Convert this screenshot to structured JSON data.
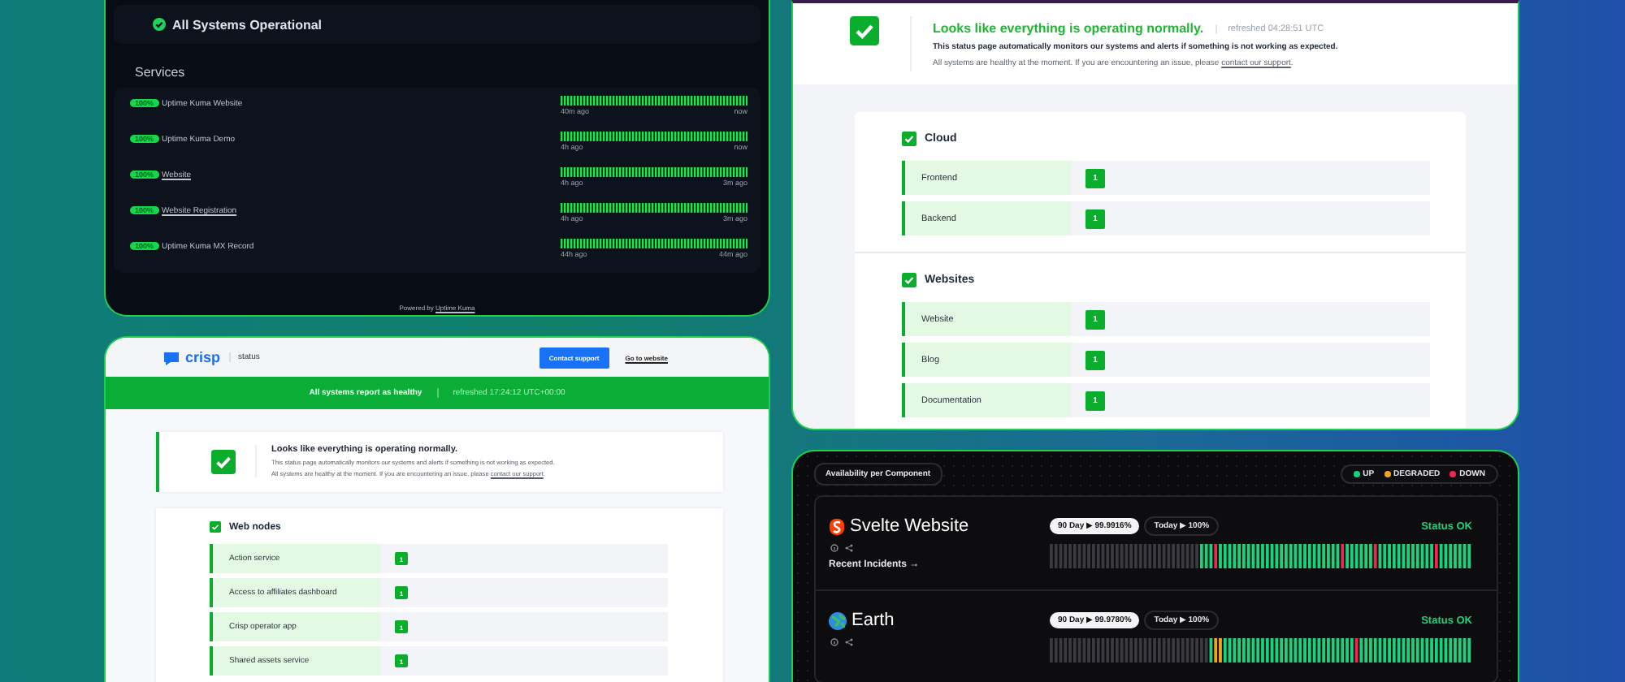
{
  "uptime_page": {
    "banner": "All Systems Operational",
    "section_title": "Services",
    "services": [
      {
        "badge": "100%",
        "name": "Uptime Kuma Website",
        "link": false,
        "since": "40m ago",
        "until": "now"
      },
      {
        "badge": "100%",
        "name": "Uptime Kuma Demo",
        "link": false,
        "since": "4h ago",
        "until": "now"
      },
      {
        "badge": "100%",
        "name": "Website",
        "link": true,
        "since": "4h ago",
        "until": "3m ago"
      },
      {
        "badge": "100%",
        "name": "Website Registration",
        "link": true,
        "since": "4h ago",
        "until": "3m ago"
      },
      {
        "badge": "100%",
        "name": "Uptime Kuma MX Record",
        "link": false,
        "since": "44h ago",
        "until": "44m ago"
      }
    ],
    "footer": {
      "text": "Powered by",
      "link": "Uptime Kuma"
    }
  },
  "crisp_page": {
    "logo": "crisp",
    "product": "status",
    "button": "Contact support",
    "website_link": "Go to website",
    "health_bar": {
      "message": "All systems report as healthy",
      "refreshed": "refreshed 17:24:12 UTC+00:00"
    },
    "summary": {
      "title": "Looks like everything is operating normally.",
      "line_1": "This status page automatically monitors our systems and alerts if something is not working as expected.",
      "line_2": "All systems are healthy at the moment. If you are encountering an issue, please",
      "link": "contact our support",
      "end": "."
    },
    "groups": [
      {
        "name": "Web nodes",
        "items": [
          {
            "name": "Action service",
            "count": "1"
          },
          {
            "name": "Access to affiliates dashboard",
            "count": "1"
          },
          {
            "name": "Crisp operator app",
            "count": "1"
          },
          {
            "name": "Shared assets service",
            "count": "1"
          }
        ]
      }
    ]
  },
  "cloud_page": {
    "summary": {
      "title": "Looks like everything is operating normally.",
      "refreshed": "refreshed 04:28:51 UTC",
      "line_1": "This status page automatically monitors our systems and alerts if something is not working as expected.",
      "line_2": "All systems are healthy at the moment. If you are encountering an issue, please",
      "link": "contact our support",
      "end": "."
    },
    "groups": [
      {
        "name": "Cloud",
        "items": [
          {
            "name": "Frontend",
            "count": "1"
          },
          {
            "name": "Backend",
            "count": "1"
          }
        ]
      },
      {
        "name": "Websites",
        "items": [
          {
            "name": "Website",
            "count": "1"
          },
          {
            "name": "Blog",
            "count": "1"
          },
          {
            "name": "Documentation",
            "count": "1"
          }
        ]
      }
    ]
  },
  "availability_page": {
    "title": "Availability per Component",
    "legend": [
      {
        "label": "UP",
        "color": "#19d27d"
      },
      {
        "label": "DEGRADED",
        "color": "#f2a31b"
      },
      {
        "label": "DOWN",
        "color": "#f0264f"
      }
    ],
    "components": [
      {
        "name": "Svelte Website",
        "ninety_day": "90 Day ▶ 99.9916%",
        "today": "Today ▶ 100%",
        "status": "Status OK",
        "incidents_link": "Recent Incidents →"
      },
      {
        "name": "Earth",
        "ninety_day": "90 Day ▶ 99.9780%",
        "today": "Today ▶ 100%",
        "status": "Status OK"
      }
    ]
  }
}
